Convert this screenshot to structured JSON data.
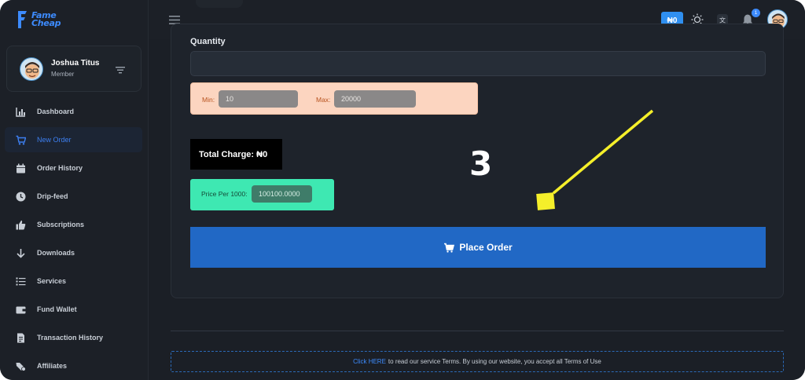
{
  "brand": {
    "line1": "Fame",
    "line2": "Cheap",
    "color": "#3d8bfd"
  },
  "profile": {
    "name": "Joshua Titus",
    "role": "Member"
  },
  "sidebar": {
    "items": [
      {
        "label": "Dashboard",
        "icon": "chart-icon",
        "active": false
      },
      {
        "label": "New Order",
        "icon": "cart-icon",
        "active": true
      },
      {
        "label": "Order History",
        "icon": "calendar-icon",
        "active": false
      },
      {
        "label": "Drip-feed",
        "icon": "clock-icon",
        "active": false
      },
      {
        "label": "Subscriptions",
        "icon": "thumbs-up-icon",
        "active": false
      },
      {
        "label": "Downloads",
        "icon": "arrow-down-icon",
        "active": false
      },
      {
        "label": "Services",
        "icon": "list-icon",
        "active": false
      },
      {
        "label": "Fund Wallet",
        "icon": "wallet-icon",
        "active": false
      },
      {
        "label": "Transaction History",
        "icon": "document-icon",
        "active": false
      },
      {
        "label": "Affiliates",
        "icon": "affiliate-icon",
        "active": false
      }
    ]
  },
  "topbar": {
    "balance": "₦0",
    "notification_count": "1"
  },
  "form": {
    "quantity_label": "Quantity",
    "quantity_value": "",
    "min_label": "Min:",
    "min_value": "10",
    "max_label": "Max:",
    "max_value": "20000",
    "total_charge": "Total Charge: ₦0",
    "price_label": "Price Per 1000:",
    "price_value": "100100.0000",
    "place_order_label": "Place Order"
  },
  "annotation": {
    "step": "3",
    "arrow_color": "#f5ef2a"
  },
  "footer": {
    "link_text": "Click HERE",
    "text": "to read our service Terms. By using our website, you accept all Terms of Use"
  }
}
